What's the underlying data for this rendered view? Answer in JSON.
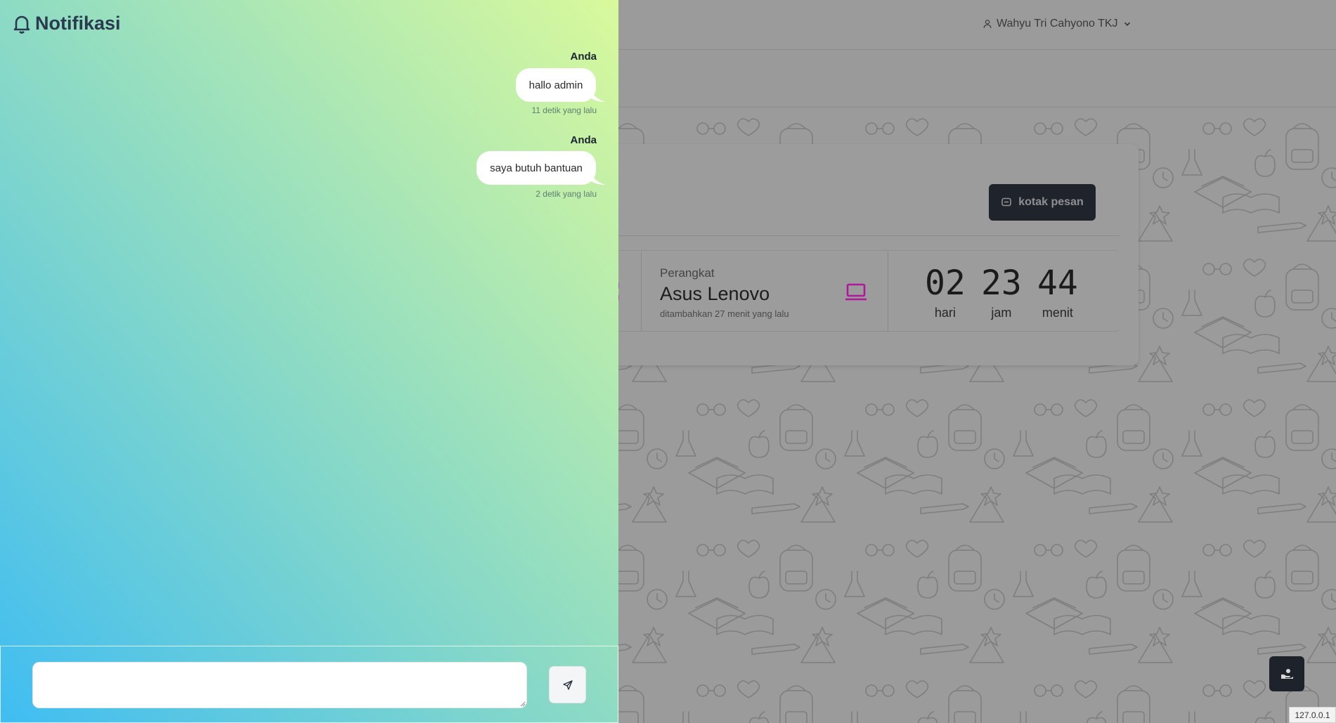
{
  "header": {
    "user_name": "Wahyu Tri Cahyono TKJ",
    "user_icon": "user-icon",
    "caret_icon": "chevron-down-icon"
  },
  "card": {
    "inbox_button_label": "kotak pesan",
    "inbox_button_icon": "message-square-icon",
    "device": {
      "label": "Perangkat",
      "value": "Asus Lenovo",
      "added": "ditambahkan 27 menit yang lalu",
      "icon": "laptop-icon",
      "icon_color": "#b0189c"
    },
    "countdown": [
      {
        "value": "02",
        "unit": "hari"
      },
      {
        "value": "23",
        "unit": "jam"
      },
      {
        "value": "44",
        "unit": "menit"
      }
    ]
  },
  "drawer": {
    "title": "Notifikasi",
    "title_icon": "bell-icon",
    "messages": [
      {
        "author": "Anda",
        "text": "hallo admin",
        "time": "11 detik yang lalu"
      },
      {
        "author": "Anda",
        "text": "saya butuh bantuan",
        "time": "2 detik yang lalu"
      }
    ],
    "composer": {
      "value": "",
      "send_icon": "send-icon"
    }
  },
  "floating_button_icon": "hand-coin-icon",
  "ip_label": "127.0.0.1",
  "colors": {
    "drawer_gradient_start": "#3fbdf2",
    "drawer_gradient_end": "#d9f99c",
    "dark_button": "#1f232b",
    "accent_magenta": "#b0189c"
  }
}
